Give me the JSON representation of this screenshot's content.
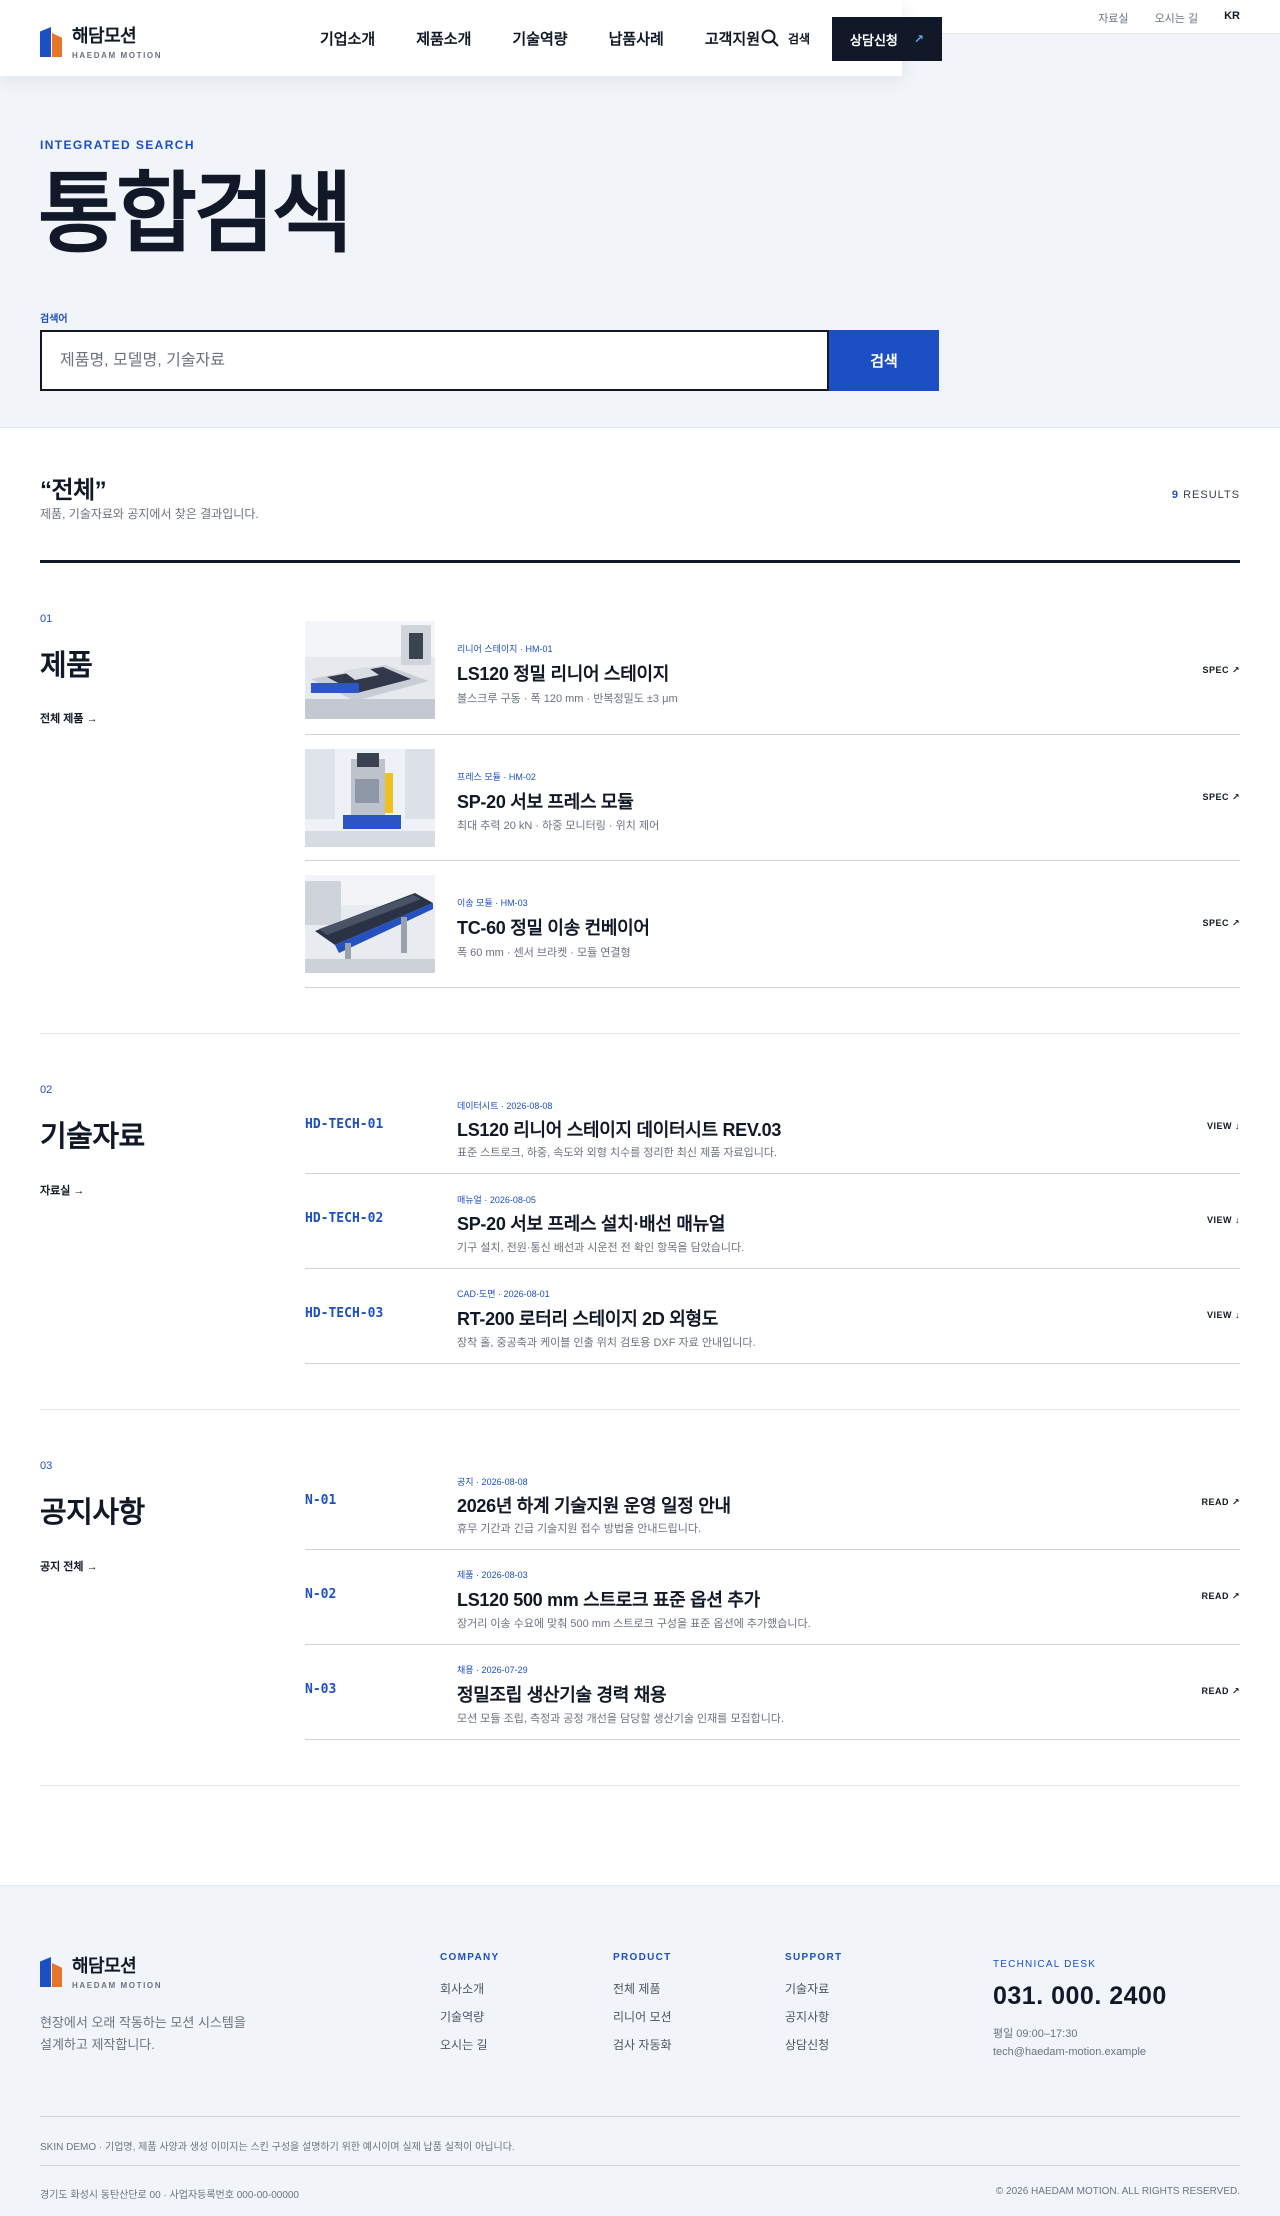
{
  "utility": [
    "자료실",
    "오시는 길",
    "KR"
  ],
  "brand": {
    "name_ko": "해담모션",
    "name_en": "HAEDAM MOTION"
  },
  "nav": [
    "기업소개",
    "제품소개",
    "기술역량",
    "납품사례",
    "고객지원"
  ],
  "header": {
    "search_label": "검색",
    "consult_label": "상담신청"
  },
  "hero": {
    "eyebrow": "INTEGRATED SEARCH",
    "title": "통합검색",
    "field_label": "검색어",
    "placeholder": "제품명, 모델명, 기술자료",
    "submit": "검색"
  },
  "results": {
    "query": "“전체”",
    "sub": "제품, 기술자료와 공지에서 찾은 결과입니다.",
    "count": "9",
    "count_label": "RESULTS"
  },
  "sections": [
    {
      "num": "01",
      "title": "제품",
      "link": "전체 제품 →",
      "items": [
        {
          "meta": "리니어 스테이지 · HM-01",
          "title": "LS120 정밀 리니어 스테이지",
          "desc": "볼스크루 구동 · 폭 120 mm · 반복정밀도 ±3 μm",
          "action": "SPEC ↗"
        },
        {
          "meta": "프레스 모듈 · HM-02",
          "title": "SP-20 서보 프레스 모듈",
          "desc": "최대 추력 20 kN · 하중 모니터링 · 위치 제어",
          "action": "SPEC ↗"
        },
        {
          "meta": "이송 모듈 · HM-03",
          "title": "TC-60 정밀 이송 컨베이어",
          "desc": "폭 60 mm · 센서 브라켓 · 모듈 연결형",
          "action": "SPEC ↗"
        }
      ]
    },
    {
      "num": "02",
      "title": "기술자료",
      "link": "자료실 →",
      "items": [
        {
          "code": "HD-TECH-01",
          "meta": "데이터시트 · 2026-08-08",
          "title": "LS120 리니어 스테이지 데이터시트 REV.03",
          "desc": "표준 스트로크, 하중, 속도와 외형 치수를 정리한 최신 제품 자료입니다.",
          "action": "VIEW ↓"
        },
        {
          "code": "HD-TECH-02",
          "meta": "매뉴얼 · 2026-08-05",
          "title": "SP-20 서보 프레스 설치·배선 매뉴얼",
          "desc": "기구 설치, 전원·통신 배선과 시운전 전 확인 항목을 담았습니다.",
          "action": "VIEW ↓"
        },
        {
          "code": "HD-TECH-03",
          "meta": "CAD·도면 · 2026-08-01",
          "title": "RT-200 로터리 스테이지 2D 외형도",
          "desc": "장착 홀, 중공축과 케이블 인출 위치 검토용 DXF 자료 안내입니다.",
          "action": "VIEW ↓"
        }
      ]
    },
    {
      "num": "03",
      "title": "공지사항",
      "link": "공지 전체 →",
      "items": [
        {
          "code": "N-01",
          "meta": "공지 · 2026-08-08",
          "title": "2026년 하계 기술지원 운영 일정 안내",
          "desc": "휴무 기간과 긴급 기술지원 접수 방법을 안내드립니다.",
          "action": "READ ↗"
        },
        {
          "code": "N-02",
          "meta": "제품 · 2026-08-03",
          "title": "LS120 500 mm 스트로크 표준 옵션 추가",
          "desc": "장거리 이송 수요에 맞춰 500 mm 스트로크 구성을 표준 옵션에 추가했습니다.",
          "action": "READ ↗"
        },
        {
          "code": "N-03",
          "meta": "채용 · 2026-07-29",
          "title": "정밀조립 생산기술 경력 채용",
          "desc": "모션 모듈 조립, 측정과 공정 개선을 담당할 생산기술 인재를 모집합니다.",
          "action": "READ ↗"
        }
      ]
    }
  ],
  "footer": {
    "tagline": "현장에서 오래 작동하는 모션 시스템을 설계하고 제작합니다.",
    "cols": [
      {
        "head": "COMPANY",
        "items": [
          "회사소개",
          "기술역량",
          "오시는 길"
        ]
      },
      {
        "head": "PRODUCT",
        "items": [
          "전체 제품",
          "리니어 모션",
          "검사 자동화"
        ]
      },
      {
        "head": "SUPPORT",
        "items": [
          "기술자료",
          "공지사항",
          "상담신청"
        ]
      }
    ],
    "desk_label": "TECHNICAL DESK",
    "tel": "031. 000. 2400",
    "hours": "평일 09:00–17:30",
    "email": "tech@haedam-motion.example",
    "note": "SKIN DEMO · 기업명, 제품 사양과 생성 이미지는 스킨 구성을 설명하기 위한 예시이며 실제 납품 실적이 아닙니다.",
    "address": "경기도 화성시 동탄산단로 00 · 사업자등록번호 000-00-00000",
    "copyright": "© 2026 HAEDAM MOTION. ALL RIGHTS RESERVED."
  }
}
